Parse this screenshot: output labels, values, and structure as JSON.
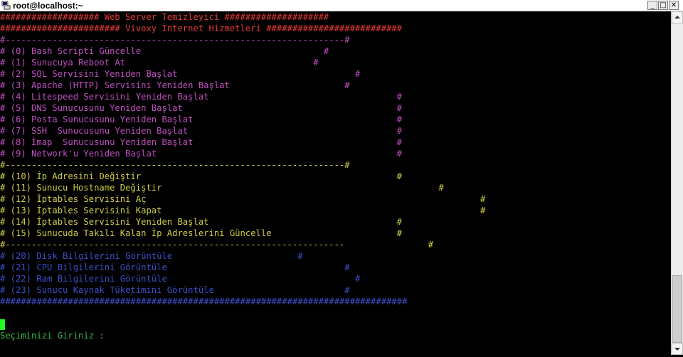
{
  "window": {
    "title": "root@localhost:~",
    "minimize_glyph": "_",
    "maximize_glyph": "□",
    "close_glyph": "✕",
    "icon": "putty-terminal-icon"
  },
  "colors": {
    "red": "#e23a36",
    "magenta": "#c04fc0",
    "yellow": "#d0d04a",
    "blue": "#3a4fc8",
    "green": "#36b84a",
    "cursor": "#22ff22"
  },
  "terminal": {
    "lines": [
      {
        "text": "################### Web Server Temizleyici ####################",
        "color": "red"
      },
      {
        "text": "####################### Vivoxy İnternet Hizmetleri ##########################",
        "color": "red"
      },
      {
        "text": "#-----------------------------------------------------------------#",
        "color": "magenta"
      },
      {
        "text": "# (0) Bash Scripti Güncelle                                   #",
        "color": "magenta"
      },
      {
        "text": "# (1) Sunucuya Reboot At                                    #",
        "color": "magenta"
      },
      {
        "text": "# (2) SQL Servisini Yeniden Başlat                                  #",
        "color": "magenta"
      },
      {
        "text": "# (3) Apache (HTTP) Servisini Yeniden Başlat                      #",
        "color": "magenta"
      },
      {
        "text": "# (4) Litespeed Servisini Yeniden Başlat                                    #",
        "color": "magenta"
      },
      {
        "text": "# (5) DNS Sunucusunu Yeniden Başlat                                         #",
        "color": "magenta"
      },
      {
        "text": "# (6) Posta Sunucusunu Yeniden Başlat                                       #",
        "color": "magenta"
      },
      {
        "text": "# (7) SSH  Sunucusunu Yeniden Başlat                                        #",
        "color": "magenta"
      },
      {
        "text": "# (8) İmap  Sunucusunu Yeniden Başlat                                       #",
        "color": "magenta"
      },
      {
        "text": "# (9) Network'u Yeniden Başlat                                              #",
        "color": "magenta"
      },
      {
        "text": "#-----------------------------------------------------------------#",
        "color": "yellow"
      },
      {
        "text": "# (10) İp Adresini Değiştir                                                 #",
        "color": "yellow"
      },
      {
        "text": "# (11) Sunucu Hostname Değiştir                                                     #",
        "color": "yellow"
      },
      {
        "text": "# (12) İptables Servisini Aç                                                                #",
        "color": "yellow"
      },
      {
        "text": "# (13) İptables Servisini Kapat                                                             #",
        "color": "yellow"
      },
      {
        "text": "# (14) İptables Servisini Yeniden Başlat                                    #",
        "color": "yellow"
      },
      {
        "text": "# (15) Sunucuda Takılı Kalan İp Adreslerini Güncelle                        #",
        "color": "yellow"
      },
      {
        "text": "#-----------------------------------------------------------------                #",
        "color": "yellow"
      },
      {
        "text": "# (20) Disk Bilgilerini Görüntüle                        #",
        "color": "blue"
      },
      {
        "text": "# (21) CPU Bilgilerini Görüntüle                                  #",
        "color": "blue"
      },
      {
        "text": "# (22) Ram Bilgilerini Görüntüle                                    #",
        "color": "blue"
      },
      {
        "text": "# (23) Sunucu Kaynak Tüketimini Görüntüle                         #",
        "color": "blue"
      },
      {
        "text": "##############################################################################",
        "color": "blue"
      },
      {
        "text": "",
        "color": "green"
      },
      {
        "text": "",
        "color": "green"
      },
      {
        "text": "Seçiminizi Giriniz :",
        "color": "green"
      }
    ]
  }
}
